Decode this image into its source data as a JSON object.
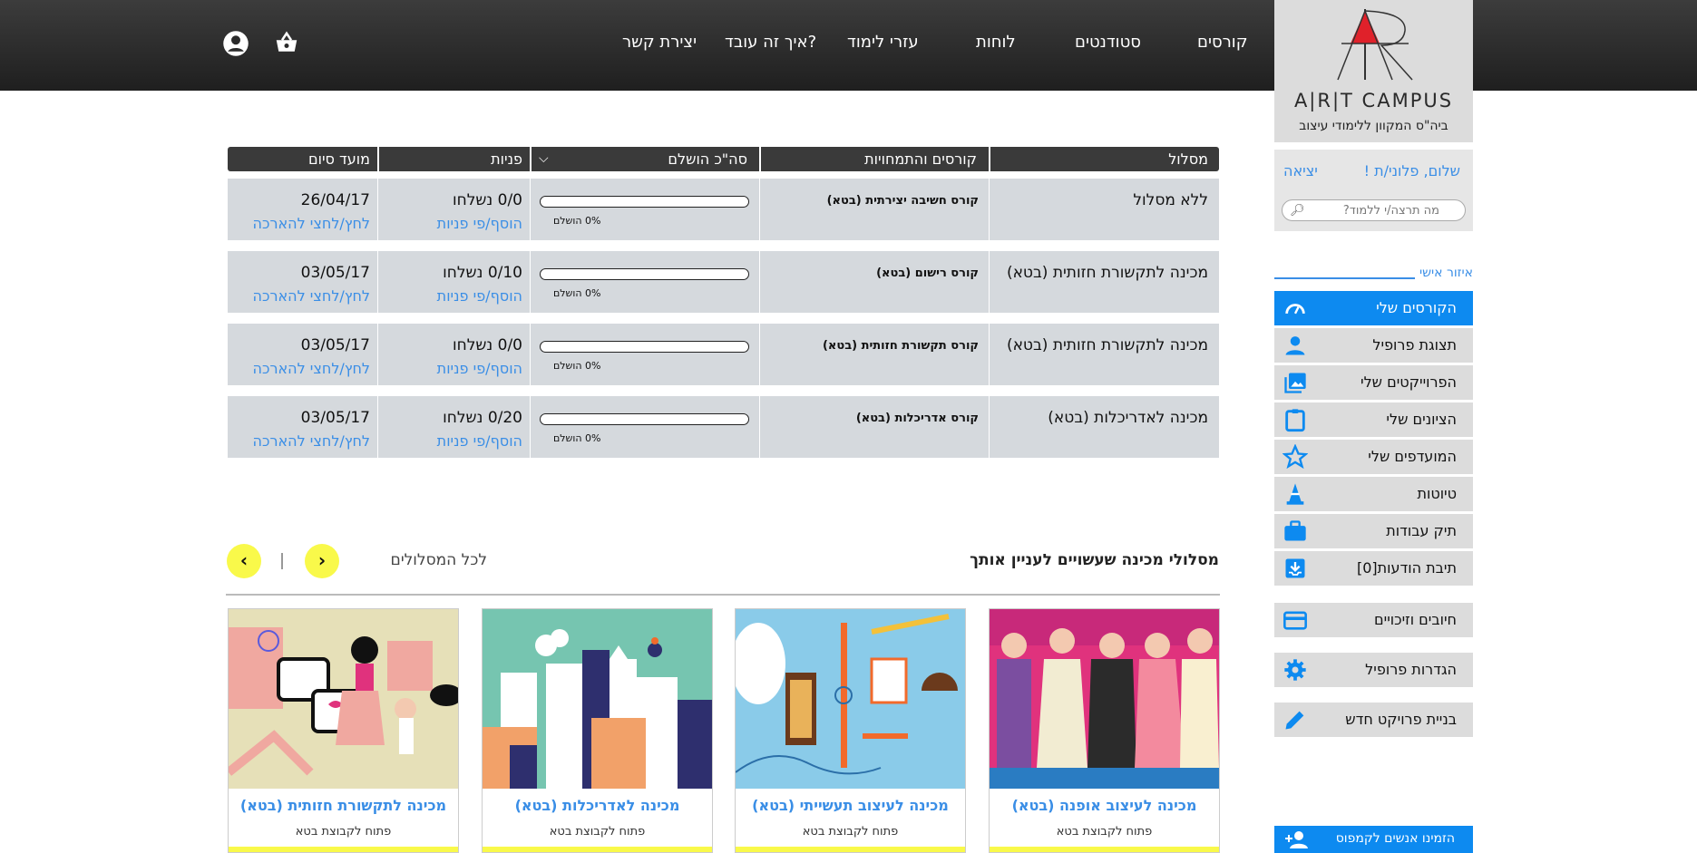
{
  "header": {
    "nav": [
      "קורסים",
      "סטודנטים",
      "לוחות",
      "עזרי לימוד",
      "איך זה עובד?",
      "יצירת קשר"
    ],
    "icons": [
      "basket-icon",
      "account-icon"
    ]
  },
  "logo": {
    "word": "A|R|T CAMPUS",
    "tagline": "ביה\"ס המקוון ללימודי עיצוב"
  },
  "user": {
    "greeting": "שלום, פלוני/ת !",
    "logout": "יציאה",
    "search_placeholder": "מה תרצה/י ללמוד?"
  },
  "sidebar": {
    "section_title": "איזור אישי",
    "items": [
      {
        "label": "הקורסים שלי",
        "icon": "speedometer-icon",
        "active": true
      },
      {
        "label": "תצוגת פרופיל",
        "icon": "person-icon"
      },
      {
        "label": "הפרוייקטים שלי",
        "icon": "gallery-icon"
      },
      {
        "label": "הציונים שלי",
        "icon": "clipboard-icon"
      },
      {
        "label": "המועדפים שלי",
        "icon": "star-icon"
      },
      {
        "label": "טיוטות",
        "icon": "cone-icon"
      },
      {
        "label": "תיק עבודות",
        "icon": "briefcase-icon"
      },
      {
        "label": "תיבת הודעות[0]",
        "icon": "inbox-icon"
      },
      {
        "label": "חיובים וזיכויים",
        "icon": "credit-card-icon"
      },
      {
        "label": "הגדרות פרופיל",
        "icon": "gear-icon"
      },
      {
        "label": "בניית פרויקט חדש",
        "icon": "pencil-icon"
      }
    ],
    "invite": "הזמינו אנשים לקמפוס"
  },
  "table": {
    "headers": {
      "track": "מסלול",
      "courses": "קורסים והתמחויות",
      "completed": "סה\"כ הושלם",
      "requests": "פניות",
      "deadline": "מועד סיום"
    },
    "rows": [
      {
        "track": "ללא מסלול",
        "course": "קורס חשיבה יצירתית (בטא)",
        "progress_label": "0% הושלם",
        "progress": 0,
        "requests": "0/0 נשלחו",
        "requests_link": "הוסף/פי פניות",
        "date": "26/04/17",
        "extend_link": "לחץ/לחצי להארכה"
      },
      {
        "track": "מכינה לתקשורת חזותית (בטא)",
        "course": "קורס רישום (בטא)",
        "progress_label": "0% הושלם",
        "progress": 0,
        "requests": "0/10 נשלחו",
        "requests_link": "הוסף/פי פניות",
        "date": "03/05/17",
        "extend_link": "לחץ/לחצי להארכה"
      },
      {
        "track": "מכינה לתקשורת חזותית (בטא)",
        "course": "קורס תקשורת חזותית (בטא)",
        "progress_label": "0% הושלם",
        "progress": 0,
        "requests": "0/0 נשלחו",
        "requests_link": "הוסף/פי פניות",
        "date": "03/05/17",
        "extend_link": "לחץ/לחצי להארכה"
      },
      {
        "track": "מכינה לאדריכלות (בטא)",
        "course": "קורס אדריכלות (בטא)",
        "progress_label": "0% הושלם",
        "progress": 0,
        "requests": "0/20 נשלחו",
        "requests_link": "הוסף/פי פניות",
        "date": "03/05/17",
        "extend_link": "לחץ/לחצי להארכה"
      }
    ]
  },
  "recommended": {
    "title": "מסלולי מכינה שעשויים לעניין אותך",
    "all_link": "לכל המסלולים",
    "cards": [
      {
        "title": "מכינה לעיצוב אופנה (בטא)",
        "status": "פתוח לקבוצת בטא",
        "image": "fashion-illustration"
      },
      {
        "title": "מכינה לעיצוב תעשייתי (בטא)",
        "status": "פתוח לקבוצת בטא",
        "image": "industrial-illustration"
      },
      {
        "title": "מכינה לאדריכלות (בטא)",
        "status": "פתוח לקבוצת בטא",
        "image": "architecture-illustration"
      },
      {
        "title": "מכינה לתקשורת חזותית (בטא)",
        "status": "פתוח לקבוצת בטא",
        "image": "visual-comm-illustration"
      }
    ]
  },
  "colors": {
    "accent": "#0d8af0",
    "link": "#3a8ee6",
    "yellow": "#f9f94a",
    "row_bg": "#d5d9dd",
    "header_bg": "#2b2b2b"
  }
}
